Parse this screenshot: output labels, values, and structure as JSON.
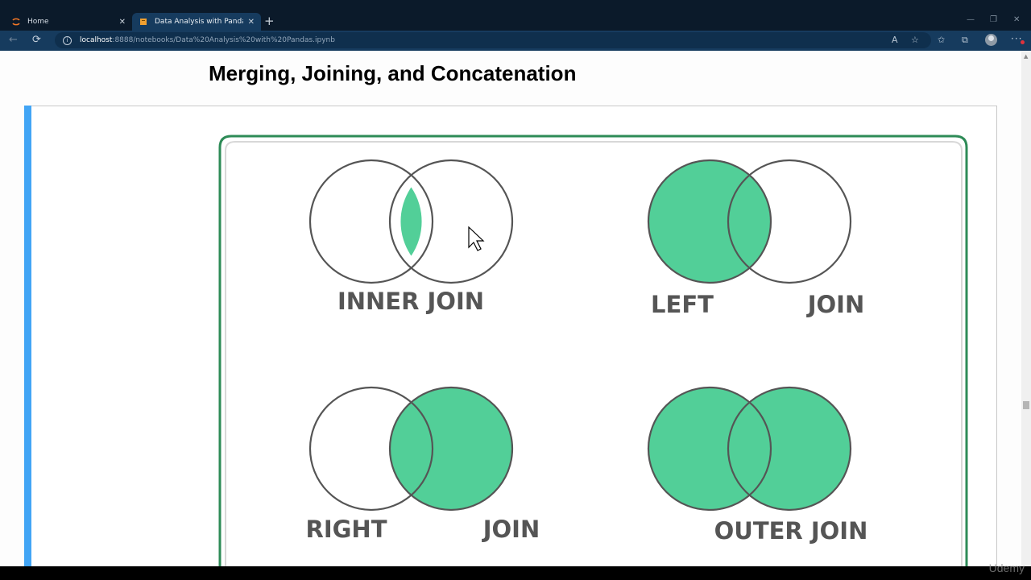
{
  "browser": {
    "tabs": [
      {
        "label": "Home",
        "icon": "jupyter-icon"
      },
      {
        "label": "Data Analysis with Pandas - Jupy",
        "icon": "notebook-icon"
      }
    ],
    "url_host": "localhost",
    "url_path": ":8888/notebooks/Data%20Analysis%20with%20Pandas.ipynb"
  },
  "notebook": {
    "heading": "Merging, Joining, and Concatenation",
    "accent_color": "#42a5f5"
  },
  "diagram": {
    "fill_color": "#52cf98",
    "frame_color": "#2e8b57",
    "joins": [
      {
        "type": "inner",
        "labels": [
          "INNER JOIN"
        ],
        "fill_left": false,
        "fill_right": false,
        "fill_overlap": true
      },
      {
        "type": "left",
        "labels": [
          "LEFT",
          "JOIN"
        ],
        "fill_left": true,
        "fill_right": false,
        "fill_overlap": true
      },
      {
        "type": "right",
        "labels": [
          "RIGHT",
          "JOIN"
        ],
        "fill_left": false,
        "fill_right": true,
        "fill_overlap": true
      },
      {
        "type": "outer",
        "labels": [
          "OUTER JOIN"
        ],
        "fill_left": true,
        "fill_right": true,
        "fill_overlap": true
      }
    ]
  },
  "watermark": "Udemy"
}
